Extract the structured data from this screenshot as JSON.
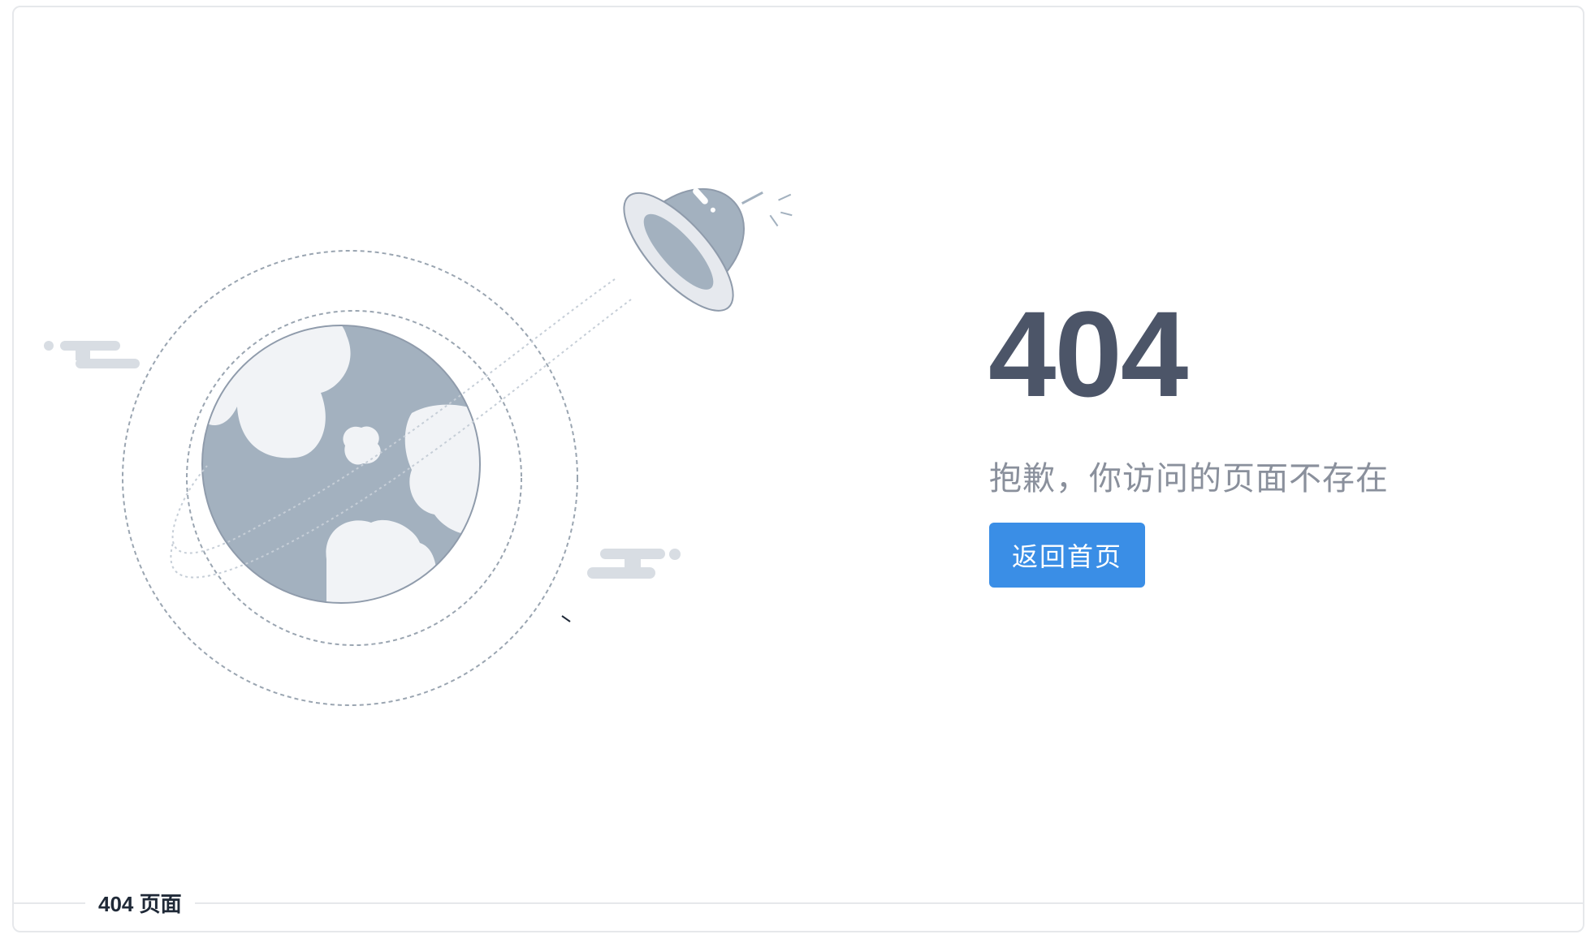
{
  "error": {
    "code": "404",
    "message": "抱歉，你访问的页面不存在",
    "button_label": "返回首页"
  },
  "footer": {
    "divider_label": "404 页面"
  },
  "colors": {
    "primary": "#3a8ee6",
    "heading": "#4c5568",
    "muted_text": "#8a909c",
    "planet": "#a3b1bf",
    "cloud": "#f1f3f6",
    "border": "#e6e8eb"
  },
  "icons": {
    "illustration": "planet-ufo-illustration"
  }
}
